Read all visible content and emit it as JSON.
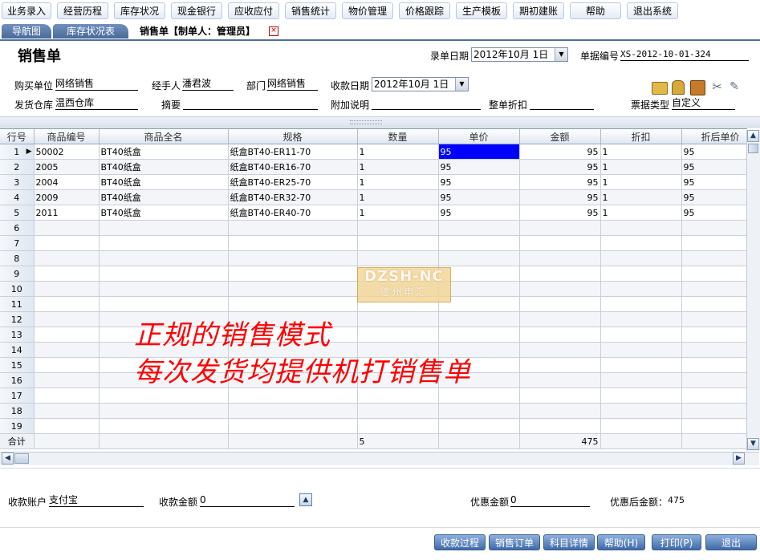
{
  "toolbar": {
    "items": [
      "业务录入",
      "经营历程",
      "库存状况",
      "现金银行",
      "应收应付",
      "销售统计",
      "物价管理",
      "价格跟踪",
      "生产模板",
      "期初建账",
      "帮助",
      "退出系统"
    ]
  },
  "tabs": {
    "nav": "导航图",
    "stock": "库存状况表",
    "active": "销售单【制单人：管理员】"
  },
  "form": {
    "title": "销售单",
    "entry_date_label": "录单日期",
    "entry_date_value": "2012年10月 1日",
    "doc_no_label": "单据编号",
    "doc_no_value": "XS-2012-10-01-324",
    "buyer_label": "购买单位",
    "buyer_value": "网络销售",
    "handler_label": "经手人",
    "handler_value": "潘君波",
    "dept_label": "部门",
    "dept_value": "网络销售",
    "pay_date_label": "收款日期",
    "pay_date_value": "2012年10月 1日",
    "warehouse_label": "发货仓库",
    "warehouse_value": "温西仓库",
    "summary_label": "摘要",
    "summary_value": "",
    "extra_label": "附加说明",
    "extra_value": "",
    "discount_label": "整单折扣",
    "discount_value": "",
    "ticket_label": "票据类型",
    "ticket_value": "自定义"
  },
  "grid": {
    "headers": [
      "行号",
      "商品编号",
      "商品全名",
      "规格",
      "数量",
      "单价",
      "金额",
      "折扣",
      "折后单价"
    ],
    "rows": [
      {
        "no": "1",
        "code": "50002",
        "name": "BT40纸盒",
        "spec": "纸盒BT40-ER11-70",
        "qty": "1",
        "price": "95",
        "amount": "95",
        "disc": "1",
        "dprice": "95"
      },
      {
        "no": "2",
        "code": "2005",
        "name": "BT40纸盒",
        "spec": "纸盒BT40-ER16-70",
        "qty": "1",
        "price": "95",
        "amount": "95",
        "disc": "1",
        "dprice": "95"
      },
      {
        "no": "3",
        "code": "2004",
        "name": "BT40纸盒",
        "spec": "纸盒BT40-ER25-70",
        "qty": "1",
        "price": "95",
        "amount": "95",
        "disc": "1",
        "dprice": "95"
      },
      {
        "no": "4",
        "code": "2009",
        "name": "BT40纸盒",
        "spec": "纸盒BT40-ER32-70",
        "qty": "1",
        "price": "95",
        "amount": "95",
        "disc": "1",
        "dprice": "95"
      },
      {
        "no": "5",
        "code": "2011",
        "name": "BT40纸盒",
        "spec": "纸盒BT40-ER40-70",
        "qty": "1",
        "price": "95",
        "amount": "95",
        "disc": "1",
        "dprice": "95"
      }
    ],
    "empty_rows": [
      "6",
      "7",
      "8",
      "9",
      "10",
      "11",
      "12",
      "13",
      "14",
      "15",
      "16",
      "17",
      "18",
      "19"
    ],
    "total_label": "合计",
    "total_qty": "5",
    "total_amount": "475"
  },
  "overlay": {
    "watermark_top": "DZSH-NC",
    "watermark_bottom": "德州申汇",
    "slogan_line1": "正规的销售模式",
    "slogan_line2": "每次发货均提供机打销售单"
  },
  "footer": {
    "account_label": "收款账户",
    "account_value": "支付宝",
    "amount_label": "收款金额",
    "amount_value": "0",
    "discount_amt_label": "优惠金额",
    "discount_amt_value": "0",
    "after_label": "优惠后金额：",
    "after_value": "475",
    "buttons": [
      "收款过程",
      "销售订单",
      "科目详情",
      "帮助(H)",
      "打印(P)",
      "退出"
    ]
  },
  "colors": {
    "selected_cell": "#0000ff",
    "slogan": "#ff0000",
    "button": "#3f6aa8"
  }
}
